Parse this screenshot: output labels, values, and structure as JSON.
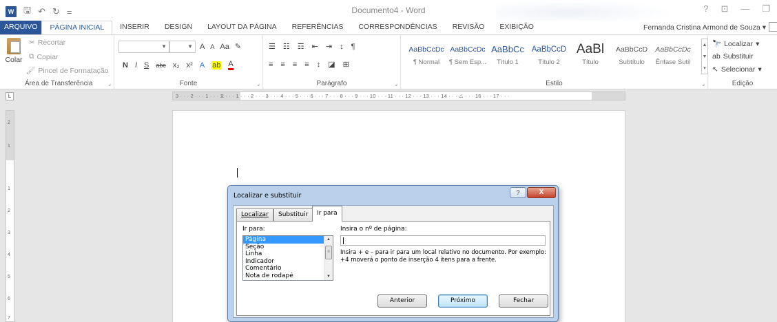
{
  "titlebar": {
    "doc_title": "Documento4 - Word",
    "word_logo": "W",
    "qat_save": "🖫",
    "qat_undo": "↶",
    "qat_redo": "↻",
    "qat_more": "=",
    "help": "?",
    "ribbon_display": "⊡",
    "minimize": "—",
    "restore": "❐"
  },
  "tabs": {
    "file": "ARQUIVO",
    "home": "PÁGINA INICIAL",
    "insert": "INSERIR",
    "design": "DESIGN",
    "layout": "LAYOUT DA PÁGINA",
    "references": "REFERÊNCIAS",
    "mailings": "CORRESPONDÊNCIAS",
    "review": "REVISÃO",
    "view": "EXIBIÇÃO"
  },
  "user": {
    "name": "Fernanda Cristina Armond de Souza",
    "arrow": "▾"
  },
  "ribbon": {
    "clipboard": {
      "label": "Área de Transferência",
      "paste": "Colar",
      "cut": "Recortar",
      "copy": "Copiar",
      "format_painter": "Pincel de Formatação"
    },
    "font": {
      "label": "Fonte",
      "font_name": "",
      "font_size": "",
      "grow": "A",
      "shrink": "A",
      "case": "Aa",
      "clear": "✎",
      "bold": "N",
      "italic": "I",
      "underline": "S",
      "strike": "abc",
      "subscript": "x₂",
      "superscript": "x²",
      "effects": "A",
      "highlight": "ab",
      "color": "A"
    },
    "paragraph": {
      "label": "Parágrafo",
      "bullets": "☰",
      "numbering": "☷",
      "multilevel": "☶",
      "decrease_indent": "⇤",
      "increase_indent": "⇥",
      "sort": "↕",
      "pilcrow": "¶",
      "align_left": "≡",
      "align_center": "≡",
      "align_right": "≡",
      "justify": "≡",
      "line_spacing": "↕",
      "shading": "◪",
      "borders": "⊞"
    },
    "styles": {
      "label": "Estilo",
      "items": [
        {
          "sample": "AaBbCcDc",
          "name": "¶ Normal"
        },
        {
          "sample": "AaBbCcDc",
          "name": "¶ Sem Esp..."
        },
        {
          "sample": "AaBbCc",
          "name": "Título 1"
        },
        {
          "sample": "AaBbCcD",
          "name": "Título 2"
        },
        {
          "sample": "AaBl",
          "name": "Título"
        },
        {
          "sample": "AaBbCcD",
          "name": "Subtítulo"
        },
        {
          "sample": "AaBbCcDc",
          "name": "Ênfase Sutil"
        }
      ]
    },
    "editing": {
      "label": "Edição",
      "find": "Localizar",
      "replace": "Substituir",
      "select": "Selecionar"
    }
  },
  "ruler": {
    "ticks": "3 · · · 2 · · · 1 · · · ⧖ · · · 1 · · · 2 · · · 3 · · · 4 · · · 5 · · · 6 · · · 7 · · · 8 · · · 9 · · · 10 · · · 11 · · · 12 · · · 13 · · · 14 · · · △ · · · 16 · · · 17 · · ·",
    "corner": "L",
    "vnums": [
      "2",
      "1",
      "1",
      "2",
      "3",
      "4",
      "5",
      "6",
      "7"
    ]
  },
  "dialog": {
    "title": "Localizar e substituir",
    "help": "?",
    "close": "X",
    "tabs": [
      {
        "label": "Localizar"
      },
      {
        "label": "Substituir"
      },
      {
        "label": "Ir para"
      }
    ],
    "goto_what_label": "Ir para:",
    "goto_items": [
      "Página",
      "Seção",
      "Linha",
      "Indicador",
      "Comentário",
      "Nota de rodapé"
    ],
    "selected_item": "Página",
    "page_label": "Insira o nº de página:",
    "page_value": "",
    "help_text": "Insira + e – para ir para um local relativo no documento. Por exemplo: +4 moverá o ponto de inserção 4 itens para a frente.",
    "buttons": {
      "previous": "Anterior",
      "next": "Próximo",
      "close": "Fechar"
    }
  }
}
